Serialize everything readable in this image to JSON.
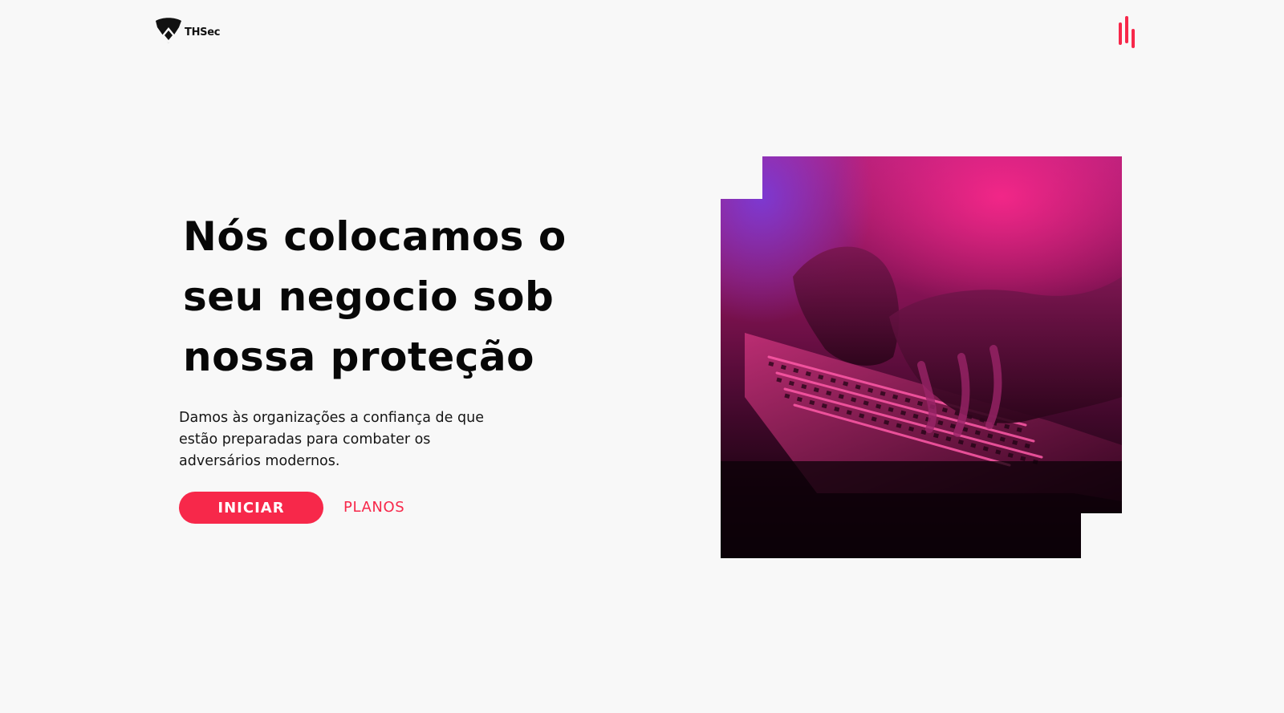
{
  "header": {
    "logo_text": "THSec"
  },
  "hero": {
    "title_lines": [
      "Nós colocamos o",
      "seu negocio sob",
      "nossa proteção"
    ],
    "description": "Damos às organizações a confiança de que estão preparadas para combater os adversários modernos.",
    "primary_button": "INICIAR",
    "secondary_button": "PLANOS"
  },
  "icons": {
    "logo": "shield-logo-icon",
    "menu": "menu-bars-icon"
  },
  "colors": {
    "accent": "#f7284a",
    "background": "#f8f8f8",
    "text": "#0b0b0b"
  }
}
